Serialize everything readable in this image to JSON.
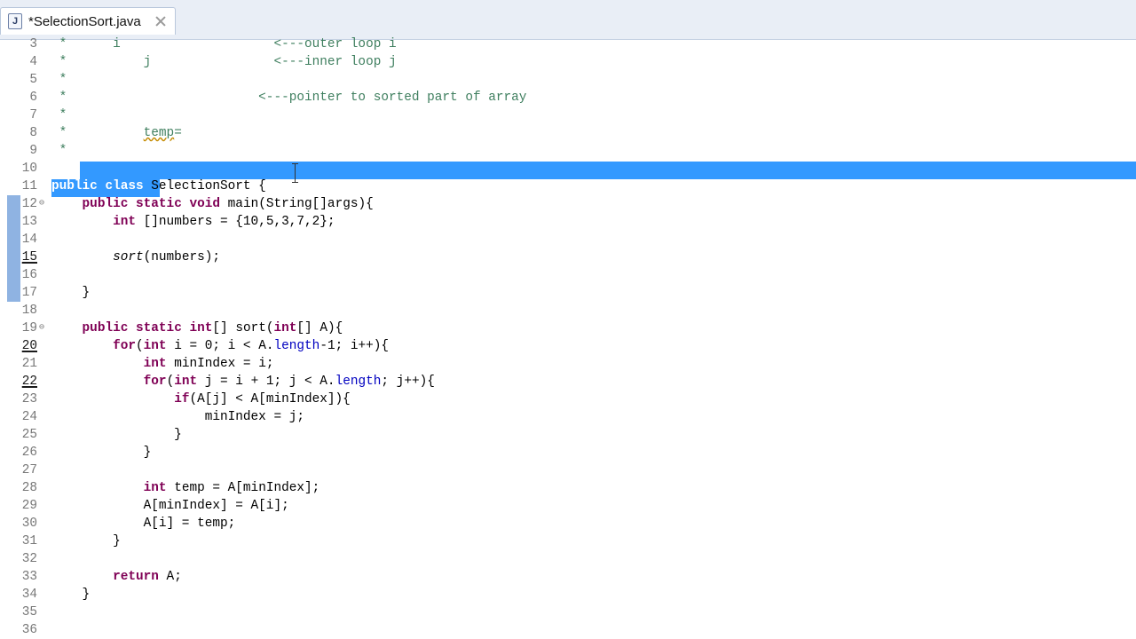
{
  "tab": {
    "title": "*SelectionSort.java",
    "icon": "java-file-icon"
  },
  "editor": {
    "selection_color": "#3399ff",
    "lines": [
      {
        "n": "3",
        "text": " *      i                    <---outer loop i"
      },
      {
        "n": "4",
        "text": " *          j                <---inner loop j"
      },
      {
        "n": "5",
        "text": " *"
      },
      {
        "n": "6",
        "text": " *                         <---pointer to sorted part of array"
      },
      {
        "n": "7",
        "text": " *"
      },
      {
        "n": "8",
        "text": " *          temp="
      },
      {
        "n": "9",
        "text": " *"
      },
      {
        "n": "10",
        "text": " */"
      },
      {
        "n": "11",
        "text": "public class SelectionSort {"
      },
      {
        "n": "12",
        "text": "    public static void main(String[]args){"
      },
      {
        "n": "13",
        "text": "        int []numbers = {10,5,3,7,2};"
      },
      {
        "n": "14",
        "text": ""
      },
      {
        "n": "15",
        "text": "        sort(numbers);"
      },
      {
        "n": "16",
        "text": ""
      },
      {
        "n": "17",
        "text": "    }"
      },
      {
        "n": "18",
        "text": ""
      },
      {
        "n": "19",
        "text": "    public static int[] sort(int[] A){"
      },
      {
        "n": "20",
        "text": "        for(int i = 0; i < A.length-1; i++){"
      },
      {
        "n": "21",
        "text": "            int minIndex = i;"
      },
      {
        "n": "22",
        "text": "            for(int j = i + 1; j < A.length; j++){"
      },
      {
        "n": "23",
        "text": "                if(A[j] < A[minIndex]){"
      },
      {
        "n": "24",
        "text": "                    minIndex = j;"
      },
      {
        "n": "25",
        "text": "                }"
      },
      {
        "n": "26",
        "text": "            }"
      },
      {
        "n": "27",
        "text": ""
      },
      {
        "n": "28",
        "text": "            int temp = A[minIndex];"
      },
      {
        "n": "29",
        "text": "            A[minIndex] = A[i];"
      },
      {
        "n": "30",
        "text": "            A[i] = temp;"
      },
      {
        "n": "31",
        "text": "        }"
      },
      {
        "n": "32",
        "text": ""
      },
      {
        "n": "33",
        "text": "        return A;"
      },
      {
        "n": "34",
        "text": "    }"
      },
      {
        "n": "35",
        "text": ""
      },
      {
        "n": "36",
        "text": ""
      }
    ]
  }
}
